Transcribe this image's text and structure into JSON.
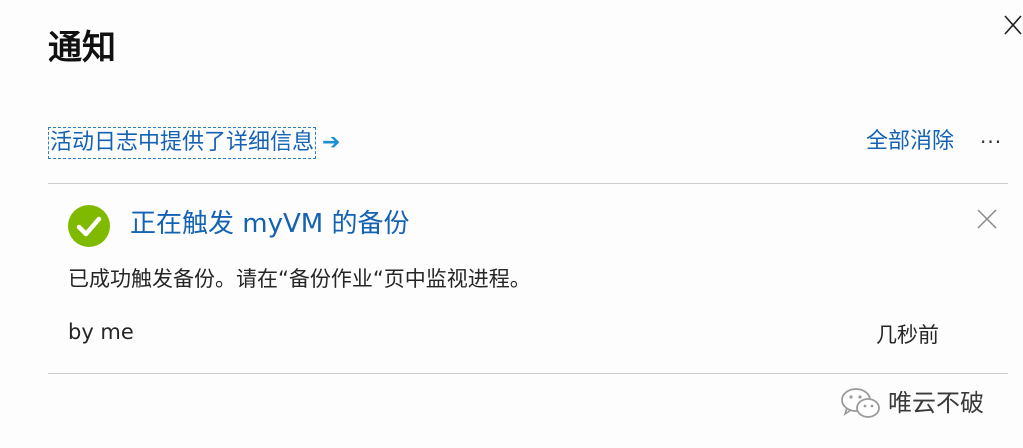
{
  "panel": {
    "title": "通知",
    "close_icon": "close-icon"
  },
  "toolbar": {
    "activity_link": "活动日志中提供了详细信息",
    "activity_arrow": "➔",
    "dismiss_all": "全部消除",
    "more": "···"
  },
  "notification": {
    "status_icon": "success-check-icon",
    "status_color": "#7fba00",
    "title": "正在触发 myVM 的备份",
    "body": "已成功触发备份。请在“备份作业“页中监视进程。",
    "by": "by me",
    "time": "几秒前"
  },
  "watermark": {
    "text": "唯云不破"
  },
  "colors": {
    "link": "#1462b3",
    "divider": "#cfcfcf",
    "text": "#262626"
  }
}
